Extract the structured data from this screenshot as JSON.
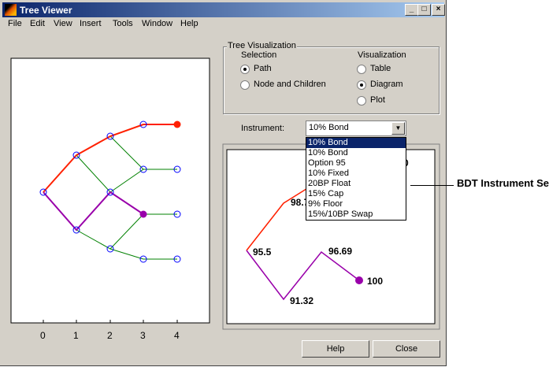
{
  "window": {
    "title": "Tree Viewer",
    "controls": [
      "_",
      "□",
      "×"
    ]
  },
  "menu": [
    "File",
    "Edit",
    "View",
    "Insert",
    "Tools",
    "Window",
    "Help"
  ],
  "tree_viz": {
    "title": "Tree Visualization",
    "selection_label": "Selection",
    "selection_options": [
      "Path",
      "Node and Children"
    ],
    "selection_selected": "Path",
    "visualization_label": "Visualization",
    "visualization_options": [
      "Table",
      "Diagram",
      "Plot"
    ],
    "visualization_selected": "Diagram"
  },
  "instrument": {
    "label": "Instrument:",
    "value": "10% Bond",
    "options": [
      "10% Bond",
      "10% Bond",
      "Option 95",
      "10% Fixed",
      "20BP Float",
      "15% Cap",
      "9% Floor",
      "15%/10BP Swap"
    ]
  },
  "tree_axis": {
    "ticks": [
      "0",
      "1",
      "2",
      "3",
      "4"
    ]
  },
  "diagram_labels": {
    "root": "95.5",
    "up": "98.7",
    "down": "91.32",
    "downup": "96.69",
    "end": "100",
    "top_partial": "0"
  },
  "buttons": {
    "help": "Help",
    "close": "Close"
  },
  "annotation": "BDT Instrument Set",
  "colors": {
    "path": "#ff2000",
    "selected": "#9900aa",
    "edge": "#008000",
    "node": "#0000ff"
  }
}
